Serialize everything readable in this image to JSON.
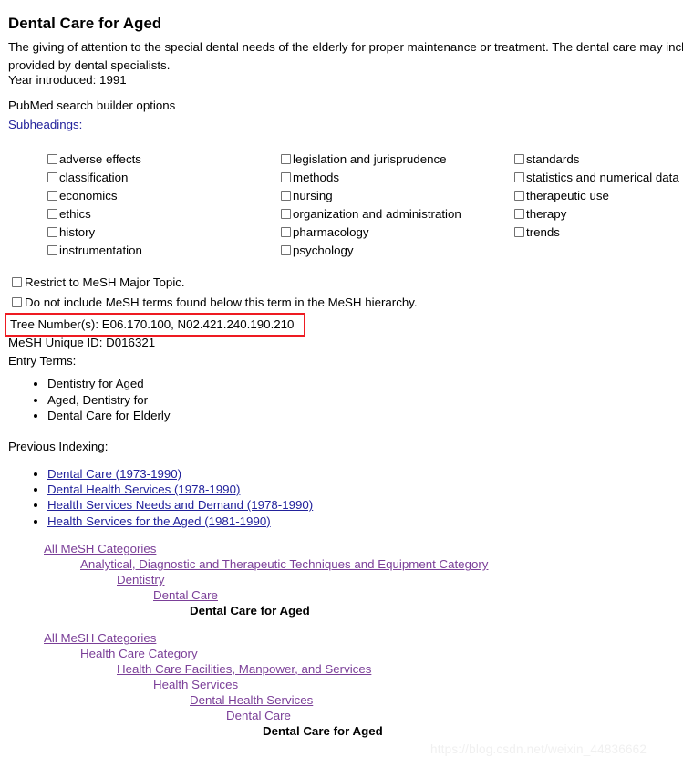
{
  "record": {
    "title": "Dental Care for Aged",
    "scope_note": "The giving of attention to the special dental needs of the elderly for proper maintenance or treatment. The dental care may includ\nprovided by dental specialists.",
    "year_introduced_line": "Year introduced: 1991",
    "tree_numbers_line": "Tree Number(s): E06.170.100, N02.421.240.190.210",
    "unique_id_line": "MeSH Unique ID: D016321",
    "entry_terms_label": "Entry Terms:",
    "entry_terms": [
      "Dentistry for Aged",
      "Aged, Dentistry for",
      "Dental Care for Elderly"
    ],
    "previous_indexing_label": "Previous Indexing:",
    "previous_indexing": [
      "Dental Care (1973-1990)",
      "Dental Health Services (1978-1990)",
      "Health Services Needs and Demand (1978-1990)",
      "Health Services for the Aged (1981-1990)"
    ]
  },
  "search_builder": {
    "options_label": "PubMed search builder options",
    "subheadings_link": "Subheadings:"
  },
  "subheadings": {
    "column1": [
      "adverse effects",
      "classification",
      "economics",
      "ethics",
      "history",
      "instrumentation"
    ],
    "column2": [
      "legislation and jurisprudence",
      "methods",
      "nursing",
      "organization and administration",
      "pharmacology",
      "psychology"
    ],
    "column3": [
      "standards",
      "statistics and numerical data",
      "therapeutic use",
      "therapy",
      "trends"
    ]
  },
  "restrict_options": [
    "Restrict to MeSH Major Topic.",
    "Do not include MeSH terms found below this term in the MeSH hierarchy."
  ],
  "mesh_trees": [
    {
      "nodes": [
        {
          "label": "All MeSH Categories",
          "indent": 0,
          "current": false
        },
        {
          "label": "Analytical, Diagnostic and Therapeutic Techniques and Equipment Category",
          "indent": 1,
          "current": false
        },
        {
          "label": "Dentistry",
          "indent": 2,
          "current": false
        },
        {
          "label": "Dental Care",
          "indent": 3,
          "current": false
        },
        {
          "label": "Dental Care for Aged",
          "indent": 4,
          "current": true
        }
      ]
    },
    {
      "nodes": [
        {
          "label": "All MeSH Categories",
          "indent": 0,
          "current": false
        },
        {
          "label": "Health Care Category",
          "indent": 1,
          "current": false
        },
        {
          "label": "Health Care Facilities, Manpower, and Services",
          "indent": 2,
          "current": false
        },
        {
          "label": "Health Services",
          "indent": 3,
          "current": false
        },
        {
          "label": "Dental Health Services",
          "indent": 4,
          "current": false
        },
        {
          "label": "Dental Care",
          "indent": 5,
          "current": false
        },
        {
          "label": "Dental Care for Aged",
          "indent": 6,
          "current": true
        }
      ]
    }
  ],
  "highlight": {
    "color": "#ee1b22"
  },
  "watermark": "https://blog.csdn.net/weixin_44836662"
}
